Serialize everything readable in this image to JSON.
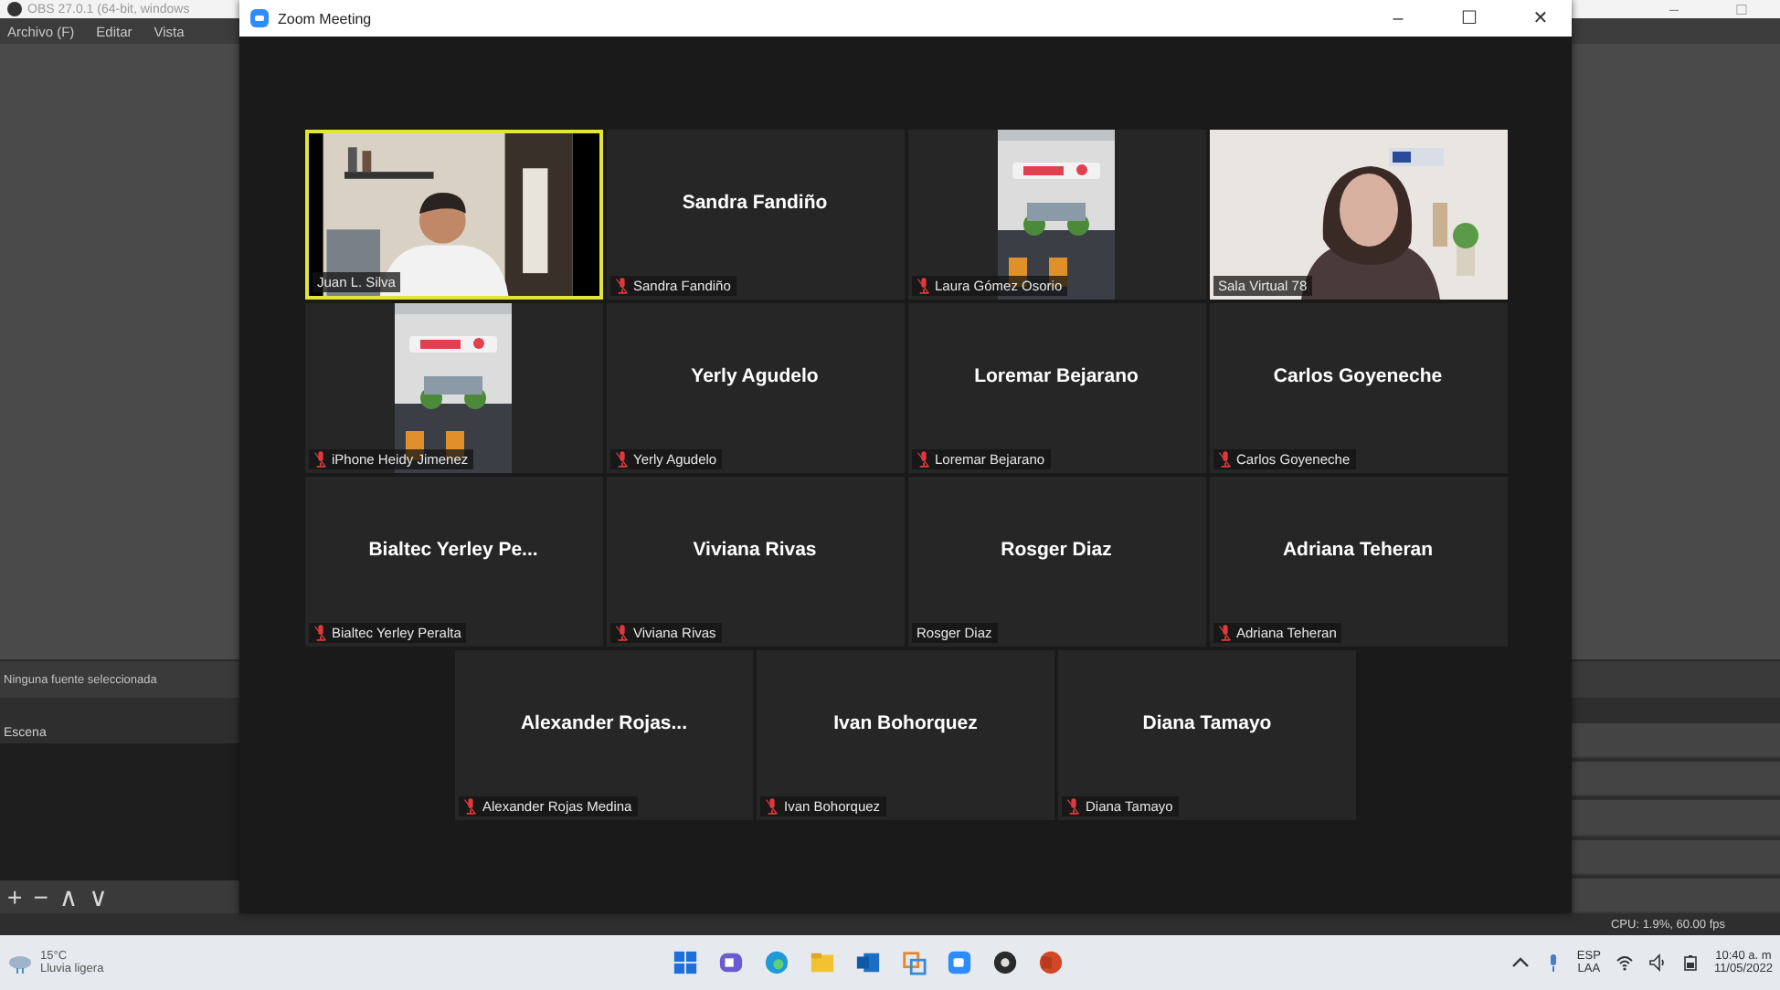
{
  "obs": {
    "title": "OBS 27.0.1 (64-bit, windows",
    "controls": [
      "–",
      "□"
    ],
    "menu": [
      "Archivo (F)",
      "Editar",
      "Vista"
    ],
    "source_status": "Ninguna fuente seleccionada",
    "scenes_header": "Escena",
    "toolbar": [
      "+",
      "−",
      "∧",
      "∨"
    ],
    "stats": "CPU: 1.9%, 60.00 fps"
  },
  "zoom": {
    "title": "Zoom Meeting",
    "controls": [
      "–",
      "☐",
      "✕"
    ],
    "rows": [
      [
        {
          "kind": "video",
          "label": "Juan L. Silva",
          "muted": false,
          "highlighted": true
        },
        {
          "kind": "name",
          "display_name": "Sandra Fandiño",
          "label": "Sandra Fandiño",
          "muted": true,
          "highlighted": false
        },
        {
          "kind": "portrait-video",
          "label": "Laura Gómez Osorio",
          "muted": true,
          "highlighted": false
        },
        {
          "kind": "video",
          "label": "Sala Virtual 78",
          "muted": false,
          "highlighted": false
        }
      ],
      [
        {
          "kind": "portrait-video",
          "label": "iPhone Heidy Jimenez",
          "muted": true,
          "highlighted": false
        },
        {
          "kind": "name",
          "display_name": "Yerly Agudelo",
          "label": "Yerly Agudelo",
          "muted": true,
          "highlighted": false
        },
        {
          "kind": "name",
          "display_name": "Loremar Bejarano",
          "label": "Loremar Bejarano",
          "muted": true,
          "highlighted": false
        },
        {
          "kind": "name",
          "display_name": "Carlos Goyeneche",
          "label": "Carlos Goyeneche",
          "muted": true,
          "highlighted": false
        }
      ],
      [
        {
          "kind": "name",
          "display_name": "Bialtec Yerley Pe...",
          "label": "Bialtec Yerley Peralta",
          "muted": true,
          "highlighted": false
        },
        {
          "kind": "name",
          "display_name": "Viviana Rivas",
          "label": "Viviana Rivas",
          "muted": true,
          "highlighted": false
        },
        {
          "kind": "name",
          "display_name": "Rosger Diaz",
          "label": "Rosger Diaz",
          "muted": false,
          "highlighted": false
        },
        {
          "kind": "name",
          "display_name": "Adriana Teheran",
          "label": "Adriana Teheran",
          "muted": true,
          "highlighted": false
        }
      ],
      [
        {
          "kind": "name",
          "display_name": "Alexander Rojas...",
          "label": "Alexander Rojas Medina",
          "muted": true,
          "highlighted": false
        },
        {
          "kind": "name",
          "display_name": "Ivan Bohorquez",
          "label": "Ivan Bohorquez",
          "muted": true,
          "highlighted": false
        },
        {
          "kind": "name",
          "display_name": "Diana Tamayo",
          "label": "Diana Tamayo",
          "muted": true,
          "highlighted": false
        }
      ]
    ]
  },
  "taskbar": {
    "weather": {
      "temperature": "15°C",
      "description": "Lluvia ligera"
    },
    "language": [
      "ESP",
      "LAA"
    ],
    "time": "10:40 a. m",
    "date": "11/05/2022"
  }
}
